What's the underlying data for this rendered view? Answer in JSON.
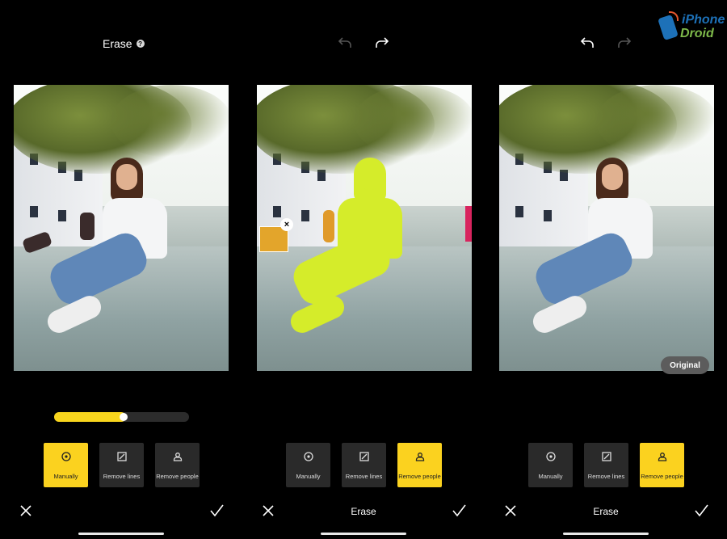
{
  "panel1": {
    "title": "Erase",
    "help_icon": "?",
    "slider_value": 0.5,
    "tools": [
      {
        "label": "Manually",
        "icon": "target-icon",
        "active": true
      },
      {
        "label": "Remove lines",
        "icon": "line-box-icon",
        "active": false
      },
      {
        "label": "Remove people",
        "icon": "person-icon",
        "active": false
      }
    ]
  },
  "panel2": {
    "bottom_title": "Erase",
    "close_selection": "×",
    "tools": [
      {
        "label": "Manually",
        "icon": "target-icon",
        "active": false
      },
      {
        "label": "Remove lines",
        "icon": "line-box-icon",
        "active": false
      },
      {
        "label": "Remove people",
        "icon": "person-icon",
        "active": true
      }
    ]
  },
  "panel3": {
    "bottom_title": "Erase",
    "original_label": "Original",
    "tools": [
      {
        "label": "Manually",
        "icon": "target-icon",
        "active": false
      },
      {
        "label": "Remove lines",
        "icon": "line-box-icon",
        "active": false
      },
      {
        "label": "Remove people",
        "icon": "person-icon",
        "active": true
      }
    ]
  },
  "logo": {
    "line1": "iPhone",
    "line2": "Droid"
  },
  "colors": {
    "accent": "#fbd21f",
    "tool_bg": "#2a2a2a",
    "mask": "#d5ec2a"
  }
}
